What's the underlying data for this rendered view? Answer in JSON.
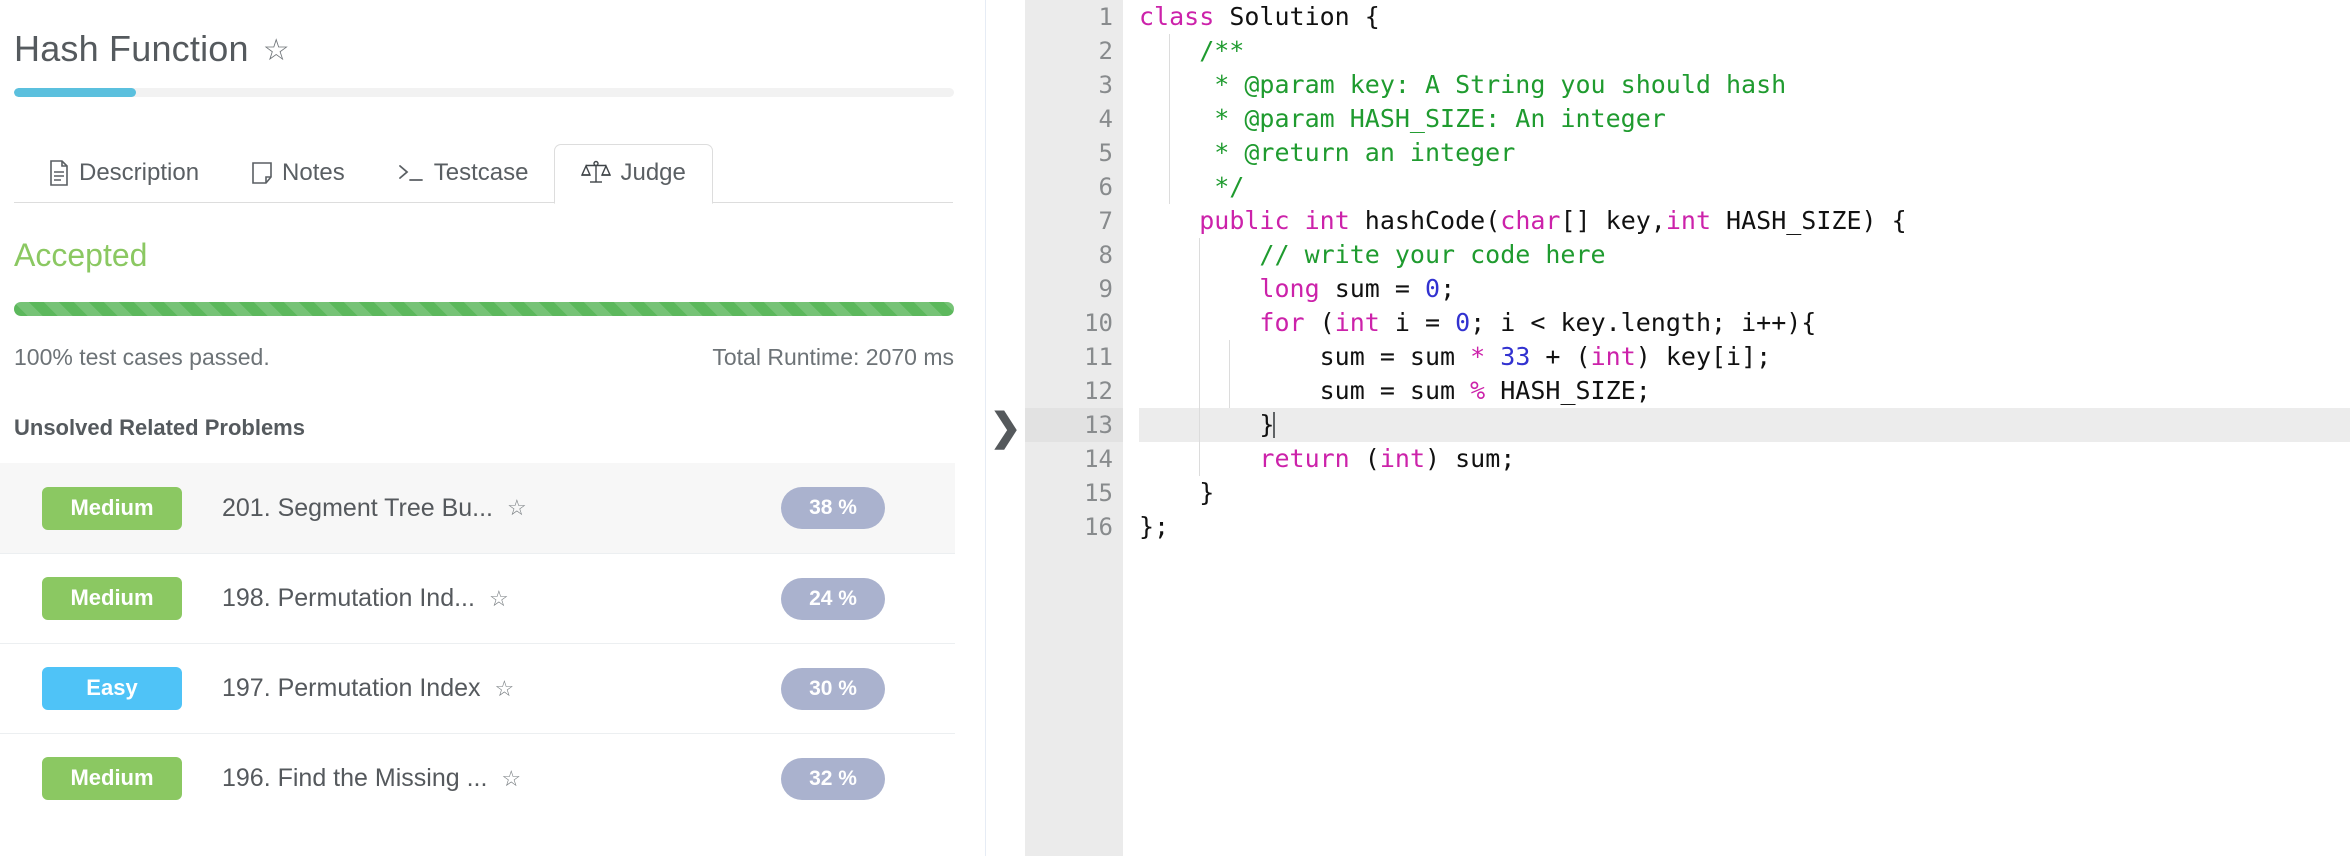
{
  "problem": {
    "title": "Hash Function",
    "star_icon": "star-outline-icon",
    "progress_percent": 13
  },
  "tabs": [
    {
      "label": "Description",
      "icon": "document-icon",
      "active": false
    },
    {
      "label": "Notes",
      "icon": "note-icon",
      "active": false
    },
    {
      "label": "Testcase",
      "icon": "terminal-prompt-icon",
      "active": false
    },
    {
      "label": "Judge",
      "icon": "scales-balance-icon",
      "active": true
    }
  ],
  "judge": {
    "verdict": "Accepted",
    "verdict_color": "#8bc862",
    "pass_bar_percent": 100,
    "pass_bar_color": "#5cb85c",
    "test_cases_text": "100% test cases passed.",
    "runtime_text": "Total Runtime: 2070 ms"
  },
  "related": {
    "heading": "Unsolved Related Problems",
    "items": [
      {
        "difficulty": "Medium",
        "difficulty_class": "medium",
        "title": "201. Segment Tree Bu...",
        "percent": "38 %",
        "star_icon": "star-outline-icon"
      },
      {
        "difficulty": "Medium",
        "difficulty_class": "medium",
        "title": "198. Permutation Ind...",
        "percent": "24 %",
        "star_icon": "star-outline-icon"
      },
      {
        "difficulty": "Easy",
        "difficulty_class": "easy",
        "title": "197. Permutation Index",
        "percent": "30 %",
        "star_icon": "star-outline-icon"
      },
      {
        "difficulty": "Medium",
        "difficulty_class": "medium",
        "title": "196. Find the Missing ...",
        "percent": "32 %",
        "star_icon": "star-outline-icon"
      }
    ]
  },
  "splitter": {
    "icon": "chevron-right-icon"
  },
  "editor": {
    "language": "java",
    "active_line": 13,
    "line_numbers": [
      "1",
      "2",
      "3",
      "4",
      "5",
      "6",
      "7",
      "8",
      "9",
      "10",
      "11",
      "12",
      "13",
      "14",
      "15",
      "16"
    ],
    "fold_lines": [
      1,
      2,
      7,
      10
    ],
    "lines": [
      "class Solution {",
      "    /**",
      "     * @param key: A String you should hash",
      "     * @param HASH_SIZE: An integer",
      "     * @return an integer",
      "     */",
      "    public int hashCode(char[] key,int HASH_SIZE) {",
      "        // write your code here",
      "        long sum = 0;",
      "        for (int i = 0; i < key.length; i++){",
      "            sum = sum * 33 + (int) key[i];",
      "            sum = sum % HASH_SIZE;",
      "        }",
      "        return (int) sum;",
      "    }",
      "};"
    ]
  }
}
